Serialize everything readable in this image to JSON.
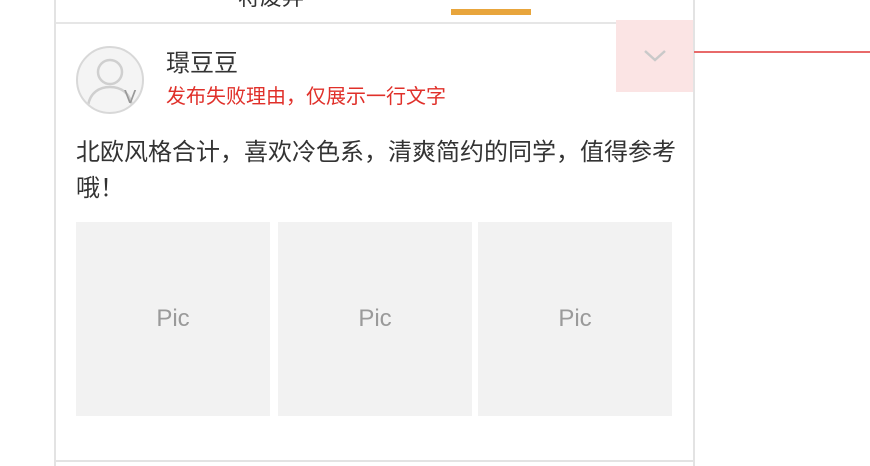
{
  "tabbar": {
    "tab_label": "将废弃"
  },
  "post": {
    "username": "璟豆豆",
    "fail_reason": "发布失败理由，仅展示一行文字",
    "verify_badge": "V",
    "text": "北欧风格合计，喜欢冷色系，清爽简约的同学，值得参考哦！",
    "pictures": [
      "Pic",
      "Pic",
      "Pic"
    ]
  },
  "icons": {
    "more": "chevron-down-icon",
    "avatar": "user-avatar-icon"
  },
  "colors": {
    "accent": "#e8a53c",
    "error_text": "#e0302a",
    "more_button_bg": "#fbe4e4",
    "pic_bg": "#f2f2f2"
  }
}
